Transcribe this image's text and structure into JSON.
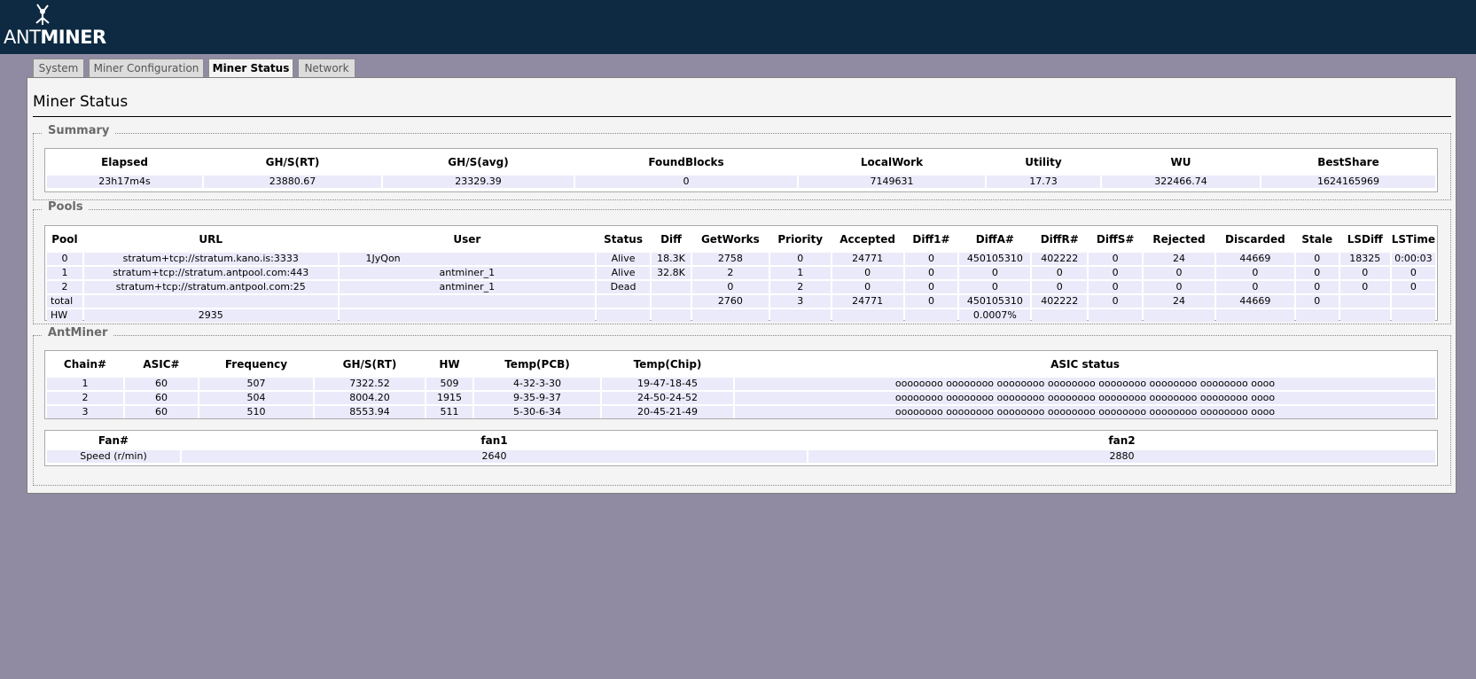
{
  "logo": {
    "part1": "ANT",
    "part2": "MINER"
  },
  "tabs": [
    "System",
    "Miner Configuration",
    "Miner Status",
    "Network"
  ],
  "page_title": "Miner Status",
  "summary": {
    "legend": "Summary",
    "headers": [
      "Elapsed",
      "GH/S(RT)",
      "GH/S(avg)",
      "FoundBlocks",
      "LocalWork",
      "Utility",
      "WU",
      "BestShare"
    ],
    "row": [
      "23h17m4s",
      "23880.67",
      "23329.39",
      "0",
      "7149631",
      "17.73",
      "322466.74",
      "1624165969"
    ]
  },
  "pools": {
    "legend": "Pools",
    "headers": [
      "Pool",
      "URL",
      "User",
      "Status",
      "Diff",
      "GetWorks",
      "Priority",
      "Accepted",
      "Diff1#",
      "DiffA#",
      "DiffR#",
      "DiffS#",
      "Rejected",
      "Discarded",
      "Stale",
      "LSDiff",
      "LSTime"
    ],
    "rows": [
      [
        "0",
        "stratum+tcp://stratum.kano.is:3333",
        "1JyQon",
        "Alive",
        "18.3K",
        "2758",
        "0",
        "24771",
        "0",
        "450105310",
        "402222",
        "0",
        "24",
        "44669",
        "0",
        "18325",
        "0:00:03"
      ],
      [
        "1",
        "stratum+tcp://stratum.antpool.com:443",
        "antminer_1",
        "Alive",
        "32.8K",
        "2",
        "1",
        "0",
        "0",
        "0",
        "0",
        "0",
        "0",
        "0",
        "0",
        "0",
        "0"
      ],
      [
        "2",
        "stratum+tcp://stratum.antpool.com:25",
        "antminer_1",
        "Dead",
        "",
        "0",
        "2",
        "0",
        "0",
        "0",
        "0",
        "0",
        "0",
        "0",
        "0",
        "0",
        "0"
      ]
    ],
    "total": {
      "label": "total",
      "getworks": "2760",
      "priority": "3",
      "accepted": "24771",
      "diff1": "0",
      "diffa": "450105310",
      "diffr": "402222",
      "diffs": "0",
      "rejected": "24",
      "discarded": "44669",
      "stale": "0"
    },
    "hw": {
      "label": "HW",
      "value": "2935",
      "pct": "0.0007%"
    }
  },
  "antminer": {
    "legend": "AntMiner",
    "headers": [
      "Chain#",
      "ASIC#",
      "Frequency",
      "GH/S(RT)",
      "HW",
      "Temp(PCB)",
      "Temp(Chip)",
      "ASIC status"
    ],
    "rows": [
      [
        "1",
        "60",
        "507",
        "7322.52",
        "509",
        "4-32-3-30",
        "19-47-18-45",
        "oooooooo oooooooo oooooooo oooooooo oooooooo oooooooo oooooooo oooo"
      ],
      [
        "2",
        "60",
        "504",
        "8004.20",
        "1915",
        "9-35-9-37",
        "24-50-24-52",
        "oooooooo oooooooo oooooooo oooooooo oooooooo oooooooo oooooooo oooo"
      ],
      [
        "3",
        "60",
        "510",
        "8553.94",
        "511",
        "5-30-6-34",
        "20-45-21-49",
        "oooooooo oooooooo oooooooo oooooooo oooooooo oooooooo oooooooo oooo"
      ]
    ]
  },
  "fans": {
    "headers": [
      "Fan#",
      "fan1",
      "fan2"
    ],
    "row_label": "Speed (r/min)",
    "values": [
      "2640",
      "2880"
    ]
  }
}
